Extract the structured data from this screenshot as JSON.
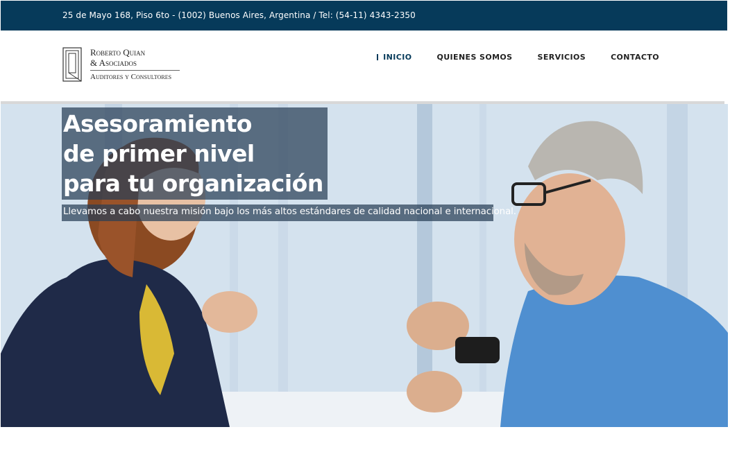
{
  "topbar": {
    "contact": "25 de Mayo 168, Piso 6to - (1002) Buenos Aires, Argentina / Tel: (54-11) 4343-2350"
  },
  "logo": {
    "line1": "Roberto Quian",
    "line2": "& Asociados",
    "line3": "Auditores y Consultores"
  },
  "nav": {
    "items": [
      {
        "label": "INICIO"
      },
      {
        "label": "QUIENES SOMOS"
      },
      {
        "label": "SERVICIOS"
      },
      {
        "label": "CONTACTO"
      }
    ]
  },
  "hero": {
    "title_lines": [
      "Asesoramiento",
      "de primer nivel",
      "para tu organización"
    ],
    "subtitle": "Llevamos a cabo nuestra misión bajo los más altos estándares de calidad nacional e internacional.",
    "image": "business-meeting-photo"
  },
  "colors": {
    "primary": "#063a5a",
    "overlay": "#283e56"
  }
}
